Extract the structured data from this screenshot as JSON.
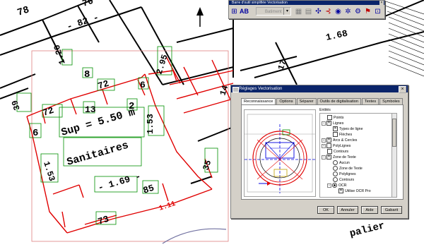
{
  "drawing": {
    "labels": {
      "l78": "78",
      "l70": "70",
      "l82": "- 82 -",
      "l120": "1.20",
      "l8": "8",
      "l72a": "72",
      "l6a": "6",
      "l295": "2.95",
      "l17": "17",
      "l168": "1.68",
      "l39": "39",
      "l72b": "72",
      "l13": "13",
      "l2": "2",
      "l153a": "1.53",
      "l6b": "6",
      "sup": "Sup = 5.50 m",
      "sanitaires": "Sanitaires",
      "l153b": "1.53",
      "l169": "- 1.69 -",
      "l85": "85",
      "l111": "1.11",
      "l73": "73",
      "l35": "35",
      "l14": "14",
      "palier": "palier"
    }
  },
  "toolbar": {
    "title": "Barre d'outil simplifiée Vectorisation",
    "close": "×",
    "select_value": "Batiment",
    "tool_icons": [
      "select-icon",
      "text-ab-icon",
      "layer-swap-icon",
      "layers-icon",
      "gear-icon",
      "node-icon",
      "circle-icon",
      "text-icon",
      "settings-icon",
      "flag-icon",
      "dimension-icon"
    ]
  },
  "dialog": {
    "title": "Réglages Vectorisation",
    "close": "×",
    "tabs": [
      "Reconnaissance",
      "Options",
      "Séparer",
      "Outils de digitalisation",
      "Textes",
      "Symboles"
    ],
    "entites_label": "Entités",
    "tree": [
      {
        "label": "Points",
        "type": "checkbox",
        "checked": false,
        "level": 1,
        "expander": ""
      },
      {
        "label": "Lignes",
        "type": "checkbox",
        "checked": true,
        "level": 1,
        "expander": "−"
      },
      {
        "label": "Types de ligne",
        "type": "checkbox",
        "checked": true,
        "level": 2,
        "expander": ""
      },
      {
        "label": "Flèches",
        "type": "checkbox",
        "checked": false,
        "level": 2,
        "expander": ""
      },
      {
        "label": "Arcs & Cercles",
        "type": "checkbox",
        "checked": true,
        "level": 1,
        "expander": "+"
      },
      {
        "label": "PolyLignes",
        "type": "checkbox",
        "checked": false,
        "level": 1,
        "expander": "+"
      },
      {
        "label": "Contours",
        "type": "checkbox",
        "checked": false,
        "level": 1,
        "expander": ""
      },
      {
        "label": "Zone de Texte",
        "type": "checkbox",
        "checked": true,
        "level": 1,
        "expander": "−"
      },
      {
        "label": "Aucun",
        "type": "radio",
        "checked": false,
        "level": 2,
        "expander": ""
      },
      {
        "label": "Zone de Texte",
        "type": "radio",
        "checked": false,
        "level": 2,
        "expander": ""
      },
      {
        "label": "Polylignes",
        "type": "radio",
        "checked": false,
        "level": 2,
        "expander": ""
      },
      {
        "label": "Contours",
        "type": "radio",
        "checked": false,
        "level": 2,
        "expander": ""
      },
      {
        "label": "OCR",
        "type": "radio",
        "checked": true,
        "level": 2,
        "expander": "−"
      },
      {
        "label": "Utilise OCR Pro",
        "type": "checkbox",
        "checked": true,
        "level": 3,
        "expander": ""
      }
    ],
    "buttons": {
      "ok": "OK",
      "annuler": "Annuler",
      "aide": "Aide",
      "gabarit": "Gabarit"
    }
  },
  "colors": {
    "red": "#e00000",
    "green": "#009000",
    "blue": "#0000e0",
    "titlebar": "#0a246a",
    "face": "#d4d0c8"
  }
}
